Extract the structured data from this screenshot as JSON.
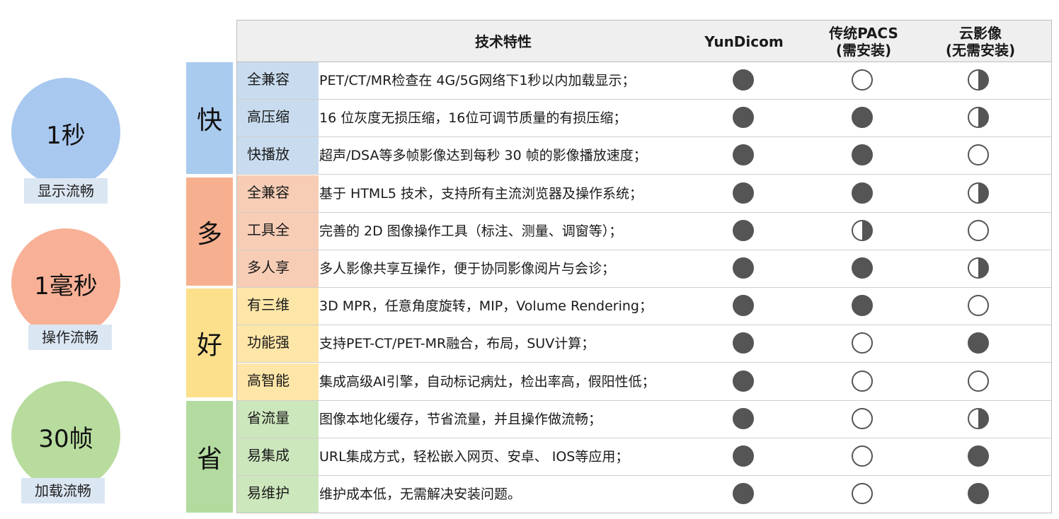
{
  "badges": [
    {
      "value": "1秒",
      "label": "显示流畅",
      "color": "#a9c8ef"
    },
    {
      "value": "1毫秒",
      "label": "操作流畅",
      "color": "#f8b196"
    },
    {
      "value": "30帧",
      "label": "加载流畅",
      "color": "#b7dc9e"
    }
  ],
  "groups": [
    {
      "label": "快",
      "color": "#a9cbee"
    },
    {
      "label": "多",
      "color": "#f7b08f"
    },
    {
      "label": "好",
      "color": "#fde08c"
    },
    {
      "label": "省",
      "color": "#b3dba0"
    }
  ],
  "table": {
    "headers": {
      "feature": "技术特性",
      "yundicom": "YunDicom",
      "pacs": "传统PACS\n(需安装)",
      "cloud": "云影像\n(无需安装)"
    },
    "rows": [
      {
        "feature": "全兼容",
        "desc": "PET/CT/MR检查在 4G/5G网络下1秒以内加载显示；",
        "yun": "full",
        "pacs": "empty",
        "cloud": "half",
        "bg": "#c9dcef"
      },
      {
        "feature": "高压缩",
        "desc": "16 位灰度无损压缩，16位可调节质量的有损压缩；",
        "yun": "full",
        "pacs": "full",
        "cloud": "half",
        "bg": "#c9dcef"
      },
      {
        "feature": "快播放",
        "desc": "超声/DSA等多帧影像达到每秒 30 帧的影像播放速度；",
        "yun": "full",
        "pacs": "full",
        "cloud": "empty",
        "bg": "#c9dcef"
      },
      {
        "feature": "全兼容",
        "desc": "基于 HTML5 技术，支持所有主流浏览器及操作系统；",
        "yun": "full",
        "pacs": "full",
        "cloud": "half",
        "bg": "#f7cdb6"
      },
      {
        "feature": "工具全",
        "desc": "完善的 2D 图像操作工具（标注、测量、调窗等）；",
        "yun": "full",
        "pacs": "half",
        "cloud": "empty",
        "bg": "#f7cdb6"
      },
      {
        "feature": "多人享",
        "desc": "多人影像共享互操作，便于协同影像阅片与会诊；",
        "yun": "full",
        "pacs": "full",
        "cloud": "half",
        "bg": "#f7cdb6"
      },
      {
        "feature": "有三维",
        "desc": "3D MPR，任意角度旋转，MIP，Volume Rendering；",
        "yun": "full",
        "pacs": "full",
        "cloud": "empty",
        "bg": "#fde6a8"
      },
      {
        "feature": "功能强",
        "desc": "支持PET-CT/PET-MR融合，布局，SUV计算；",
        "yun": "full",
        "pacs": "empty",
        "cloud": "full",
        "bg": "#fde6a8"
      },
      {
        "feature": "高智能",
        "desc": "集成高级AI引擎，自动标记病灶，检出率高，假阳性低；",
        "yun": "full",
        "pacs": "empty",
        "cloud": "empty",
        "bg": "#fde6a8"
      },
      {
        "feature": "省流量",
        "desc": "图像本地化缓存，节省流量，并且操作做流畅；",
        "yun": "full",
        "pacs": "empty",
        "cloud": "half",
        "bg": "#cde7bd"
      },
      {
        "feature": "易集成",
        "desc": "URL集成方式，轻松嵌入网页、安卓、 IOS等应用；",
        "yun": "full",
        "pacs": "empty",
        "cloud": "full",
        "bg": "#cde7bd"
      },
      {
        "feature": "易维护",
        "desc": "维护成本低，无需解决安装问题。",
        "yun": "full",
        "pacs": "empty",
        "cloud": "full",
        "bg": "#cde7bd"
      }
    ]
  }
}
